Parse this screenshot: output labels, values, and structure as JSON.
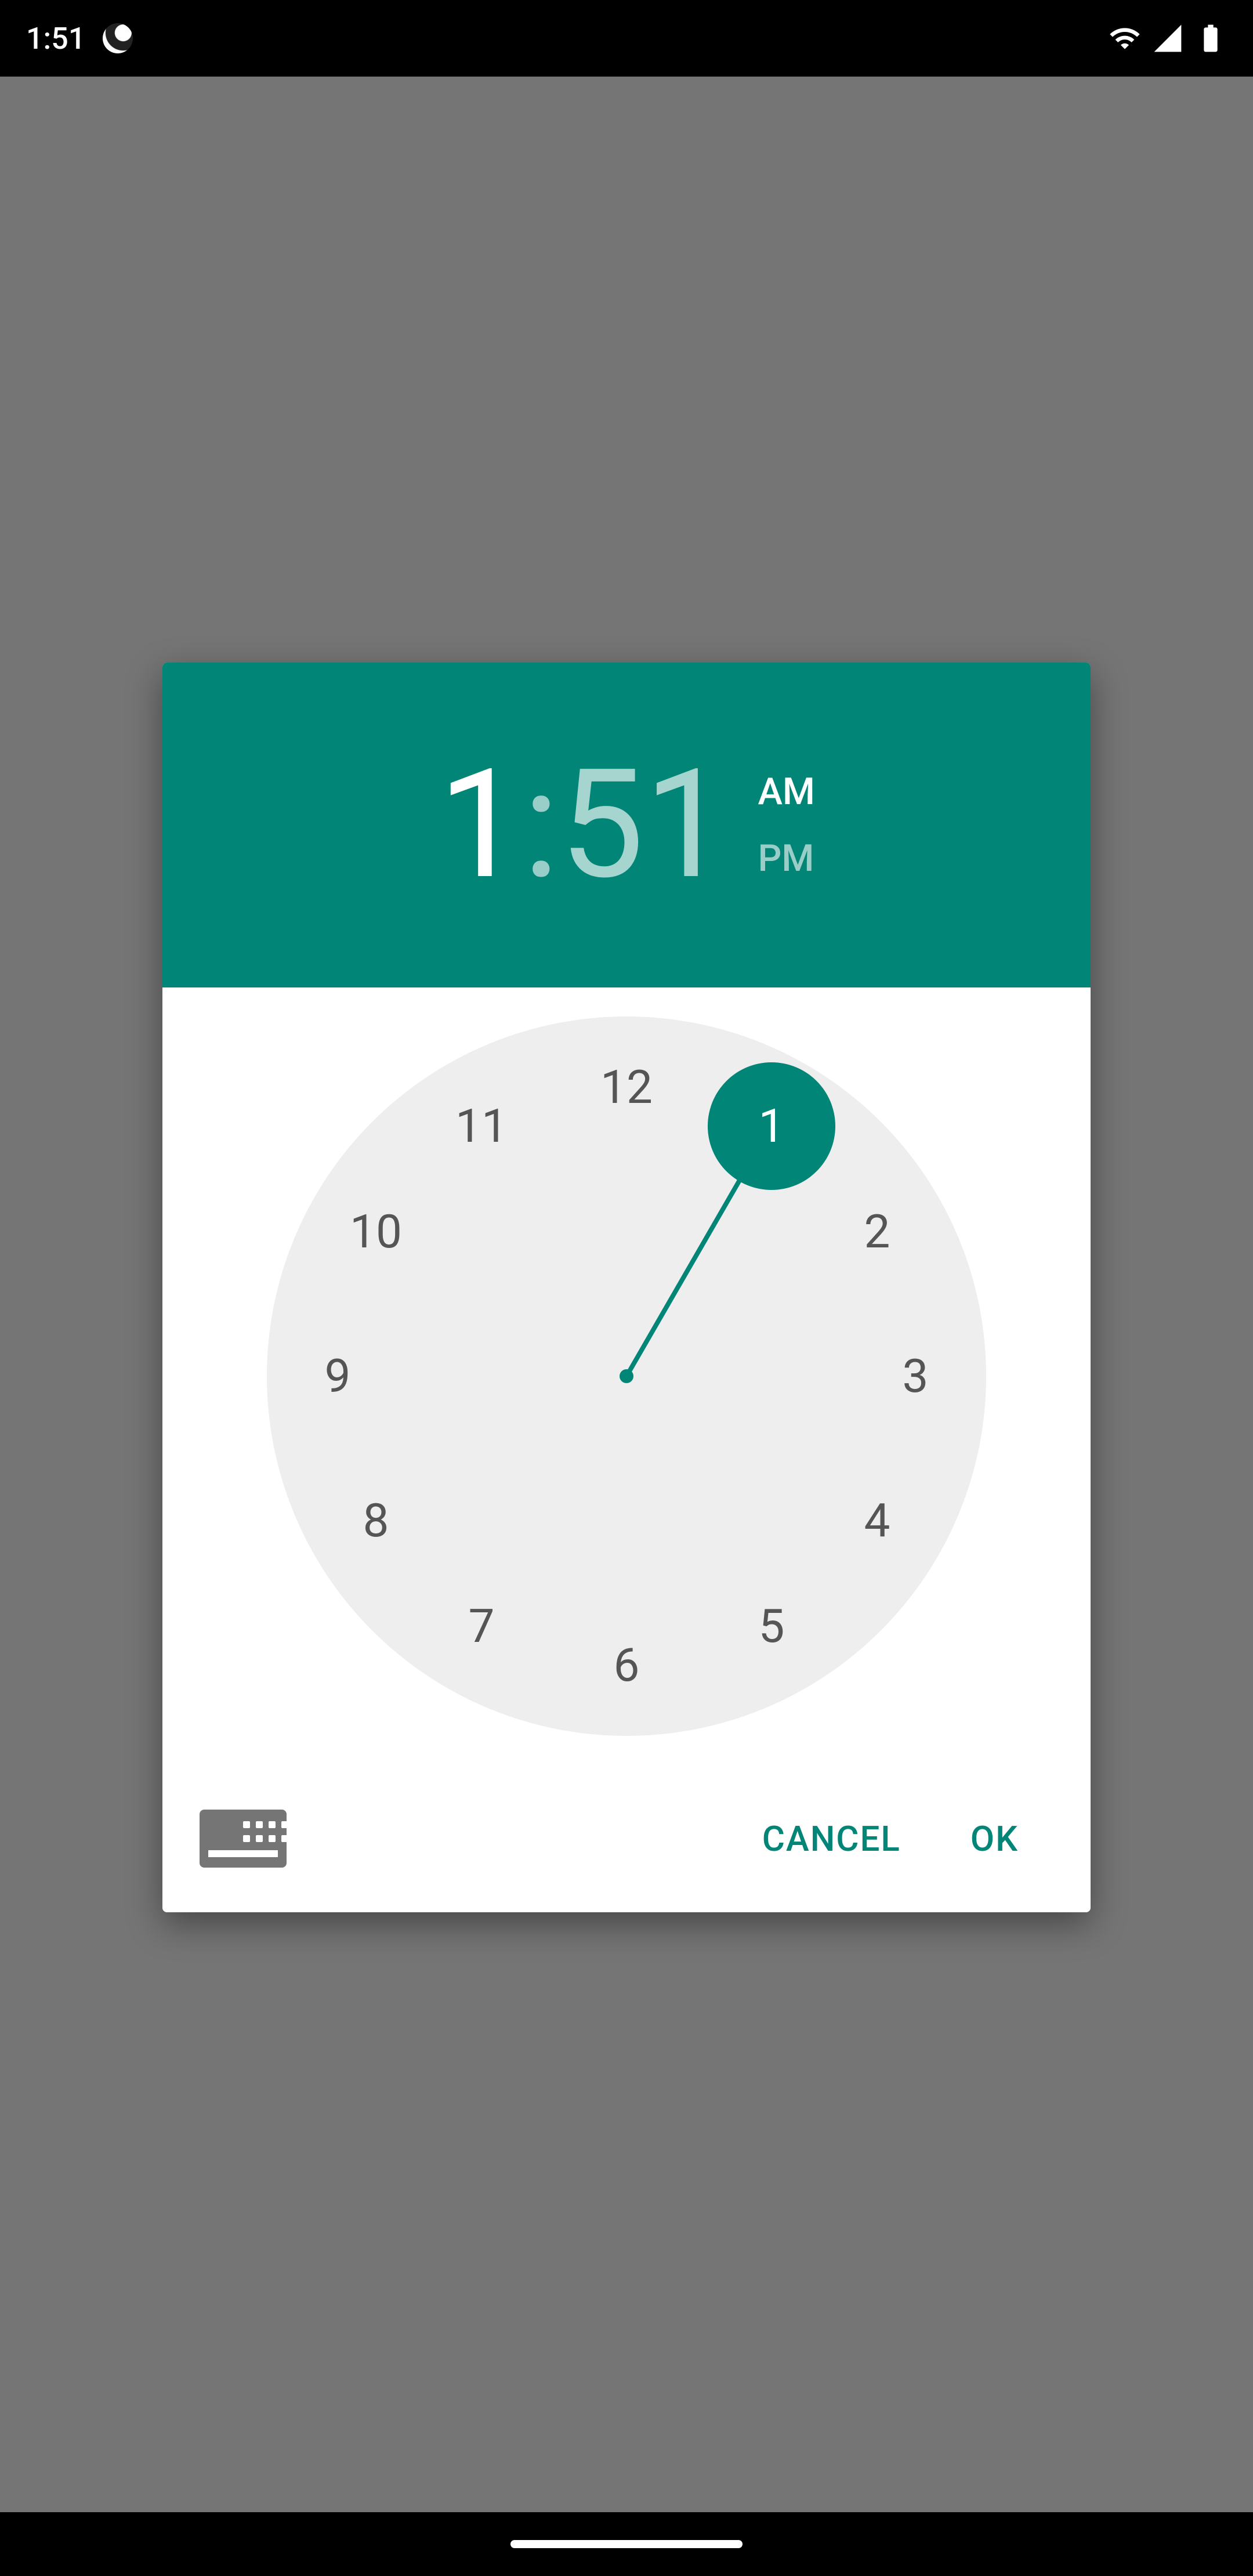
{
  "status_bar": {
    "time": "1:51"
  },
  "time_picker": {
    "hour": "1",
    "separator": ":",
    "minute": "51",
    "am_label": "AM",
    "pm_label": "PM",
    "selected_period": "AM",
    "selected_hour": 1,
    "clock_numbers": {
      "h12": "12",
      "h1": "1",
      "h2": "2",
      "h3": "3",
      "h4": "4",
      "h5": "5",
      "h6": "6",
      "h7": "7",
      "h8": "8",
      "h9": "9",
      "h10": "10",
      "h11": "11"
    }
  },
  "actions": {
    "cancel": "CANCEL",
    "ok": "OK"
  },
  "colors": {
    "primary": "#008577",
    "background_overlay": "#757575",
    "clock_face": "#eeeeee"
  }
}
